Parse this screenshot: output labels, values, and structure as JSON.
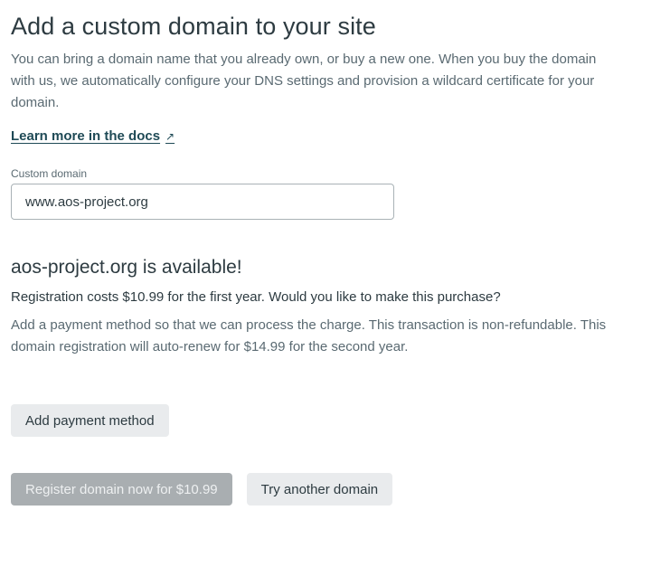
{
  "header": {
    "title": "Add a custom domain to your site",
    "intro": "You can bring a domain name that you already own, or buy a new one. When you buy the domain with us, we automatically configure your DNS settings and provision a wildcard certificate for your domain."
  },
  "docs_link": {
    "label": "Learn more in the docs",
    "icon": "external-link-icon",
    "glyph": "↗"
  },
  "custom_domain": {
    "label": "Custom domain",
    "value": "www.aos-project.org"
  },
  "availability": {
    "heading": "aos-project.org is available!",
    "question": "Registration costs $10.99 for the first year. Would you like to make this purchase?",
    "note": "Add a payment method so that we can process the charge. This transaction is non-refundable. This domain registration will auto-renew for $14.99 for the second year."
  },
  "buttons": {
    "add_payment": "Add payment method",
    "register": "Register domain now for $10.99",
    "try_another": "Try another domain"
  },
  "colors": {
    "text": "#2d3b41",
    "muted_text": "#5a6a72",
    "link": "#1f4a56",
    "secondary_button_bg": "#e9ebed",
    "disabled_button_bg": "#a9aeb1",
    "input_border": "#a9b2b6"
  }
}
